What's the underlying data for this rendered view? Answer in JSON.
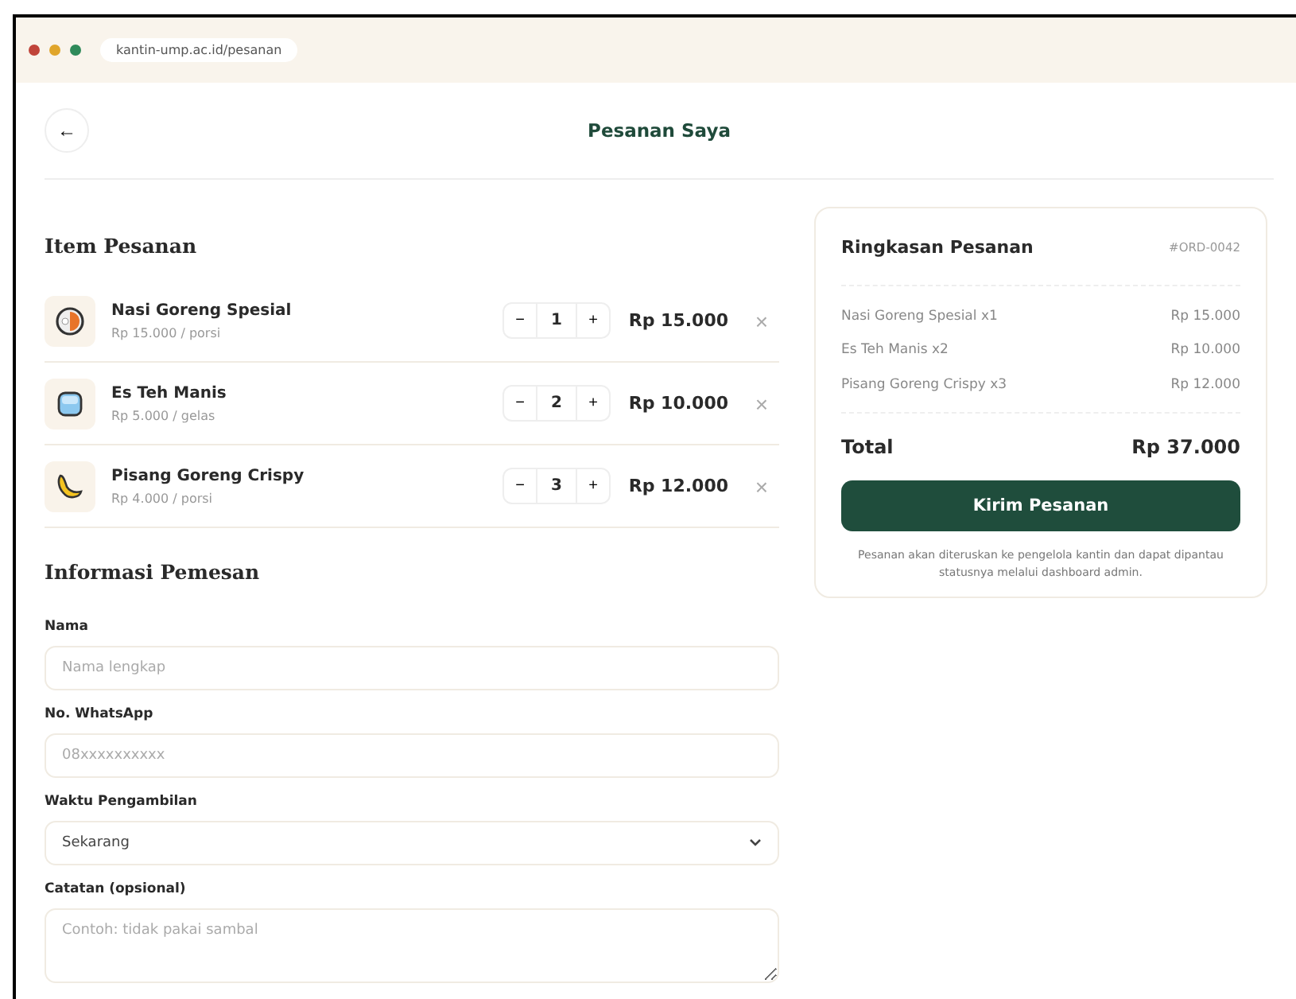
{
  "browser": {
    "url": "kantin-ump.ac.id/pesanan"
  },
  "header": {
    "back": "←",
    "title": "Pesanan Saya"
  },
  "items_section": {
    "title": "Item Pesanan",
    "items": [
      {
        "kind": "plate",
        "name": "Nasi Goreng Spesial",
        "unit_price": "Rp 15.000 / porsi",
        "minus": "−",
        "qty": "1",
        "plus": "+",
        "subtotal": "Rp 15.000",
        "remove": "×"
      },
      {
        "kind": "ice",
        "name": "Es Teh Manis",
        "unit_price": "Rp 5.000 / gelas",
        "minus": "−",
        "qty": "2",
        "plus": "+",
        "subtotal": "Rp 10.000",
        "remove": "×"
      },
      {
        "kind": "banana",
        "name": "Pisang Goreng Crispy",
        "unit_price": "Rp 4.000 / porsi",
        "minus": "−",
        "qty": "3",
        "plus": "+",
        "subtotal": "Rp 12.000",
        "remove": "×"
      }
    ]
  },
  "form": {
    "title": "Informasi Pemesan",
    "fields": [
      {
        "kind": "text",
        "label": "Nama",
        "placeholder": "Nama lengkap"
      },
      {
        "kind": "text",
        "label": "No. WhatsApp",
        "placeholder": "08xxxxxxxxxx"
      },
      {
        "kind": "select",
        "label": "Waktu Pengambilan",
        "value": "Sekarang"
      },
      {
        "kind": "textarea",
        "label": "Catatan (opsional)",
        "placeholder": "Contoh: tidak pakai sambal"
      }
    ]
  },
  "summary": {
    "title": "Ringkasan Pesanan",
    "order_id": "#ORD-0042",
    "lines": [
      {
        "label": "Nasi Goreng Spesial x1",
        "amount": "Rp 15.000"
      },
      {
        "label": "Es Teh Manis x2",
        "amount": "Rp 10.000"
      },
      {
        "label": "Pisang Goreng Crispy x3",
        "amount": "Rp 12.000"
      }
    ],
    "total_label": "Total",
    "total": "Rp 37.000",
    "button": "Kirim Pesanan",
    "note": "Pesanan akan diteruskan ke pengelola kantin dan dapat dipantau statusnya melalui dashboard admin."
  }
}
